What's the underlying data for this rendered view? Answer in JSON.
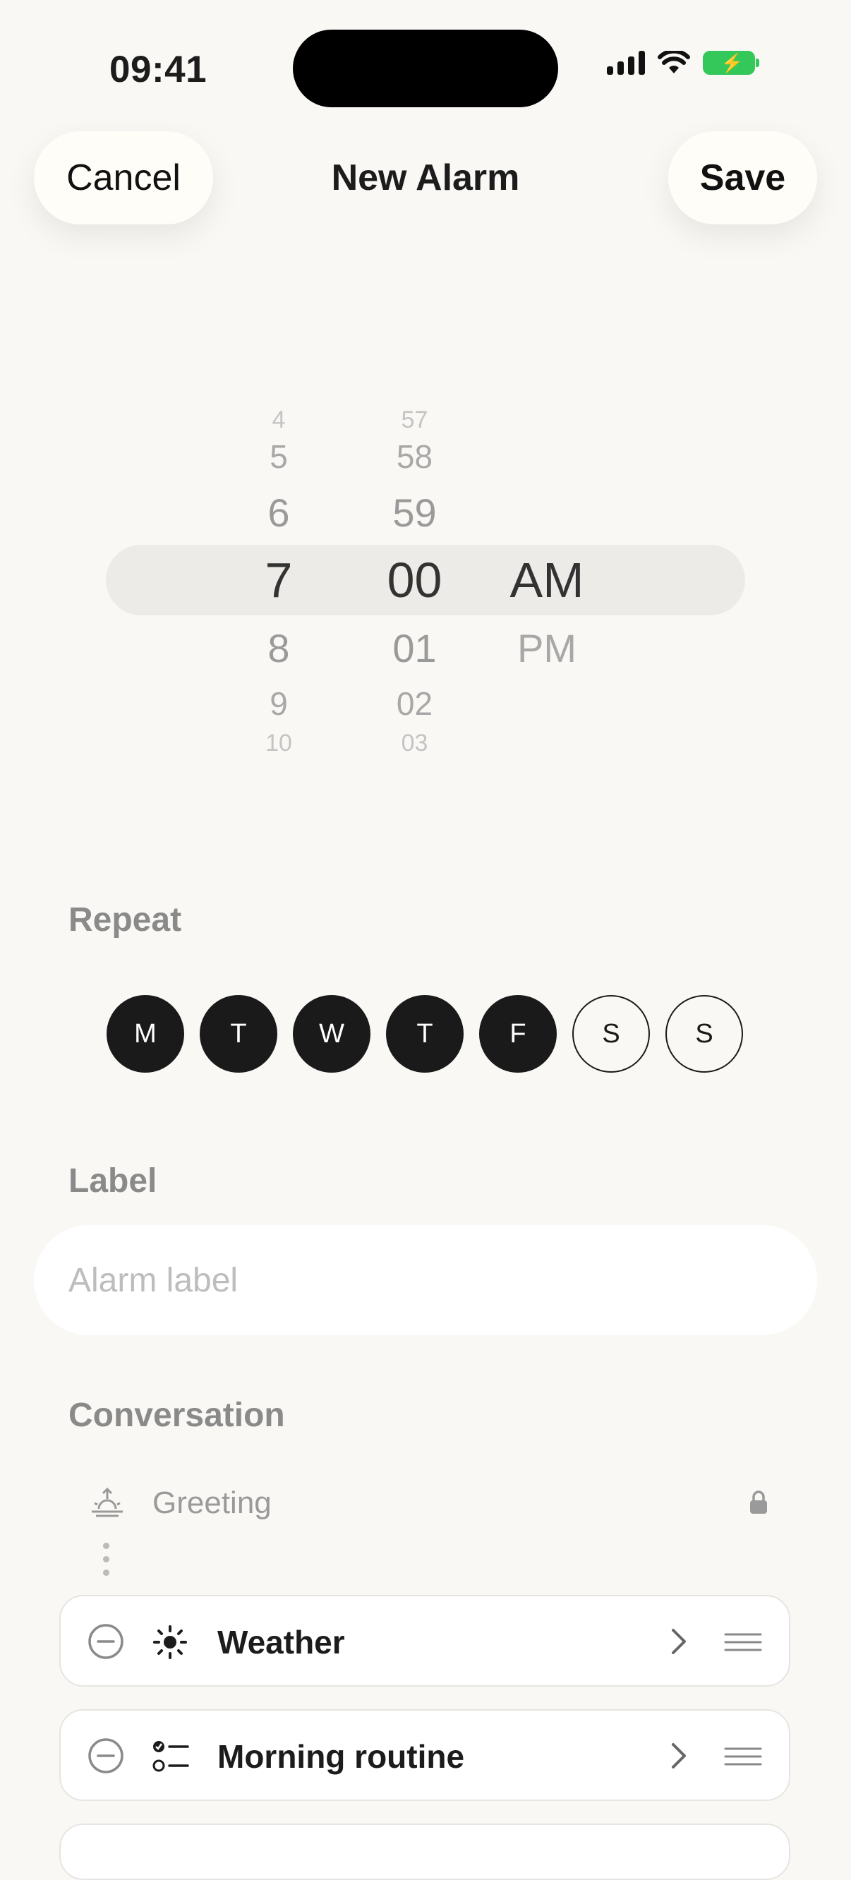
{
  "status": {
    "time": "09:41"
  },
  "header": {
    "cancel": "Cancel",
    "title": "New Alarm",
    "save": "Save"
  },
  "picker": {
    "hours": [
      "4",
      "5",
      "6",
      "7",
      "8",
      "9",
      "10"
    ],
    "minutes": [
      "57",
      "58",
      "59",
      "00",
      "01",
      "02",
      "03"
    ],
    "ampm": [
      "AM",
      "PM"
    ],
    "selected": {
      "hour": "7",
      "minute": "00",
      "period": "AM"
    }
  },
  "repeat": {
    "label": "Repeat",
    "days": [
      {
        "letter": "M",
        "selected": true
      },
      {
        "letter": "T",
        "selected": true
      },
      {
        "letter": "W",
        "selected": true
      },
      {
        "letter": "T",
        "selected": true
      },
      {
        "letter": "F",
        "selected": true
      },
      {
        "letter": "S",
        "selected": false
      },
      {
        "letter": "S",
        "selected": false
      }
    ]
  },
  "label_section": {
    "label": "Label",
    "placeholder": "Alarm label",
    "value": ""
  },
  "conversation": {
    "label": "Conversation",
    "greeting": {
      "text": "Greeting",
      "icon": "sunrise-icon",
      "locked": true
    },
    "items": [
      {
        "name": "Weather",
        "icon": "sun-icon"
      },
      {
        "name": "Morning routine",
        "icon": "checklist-icon"
      }
    ]
  }
}
